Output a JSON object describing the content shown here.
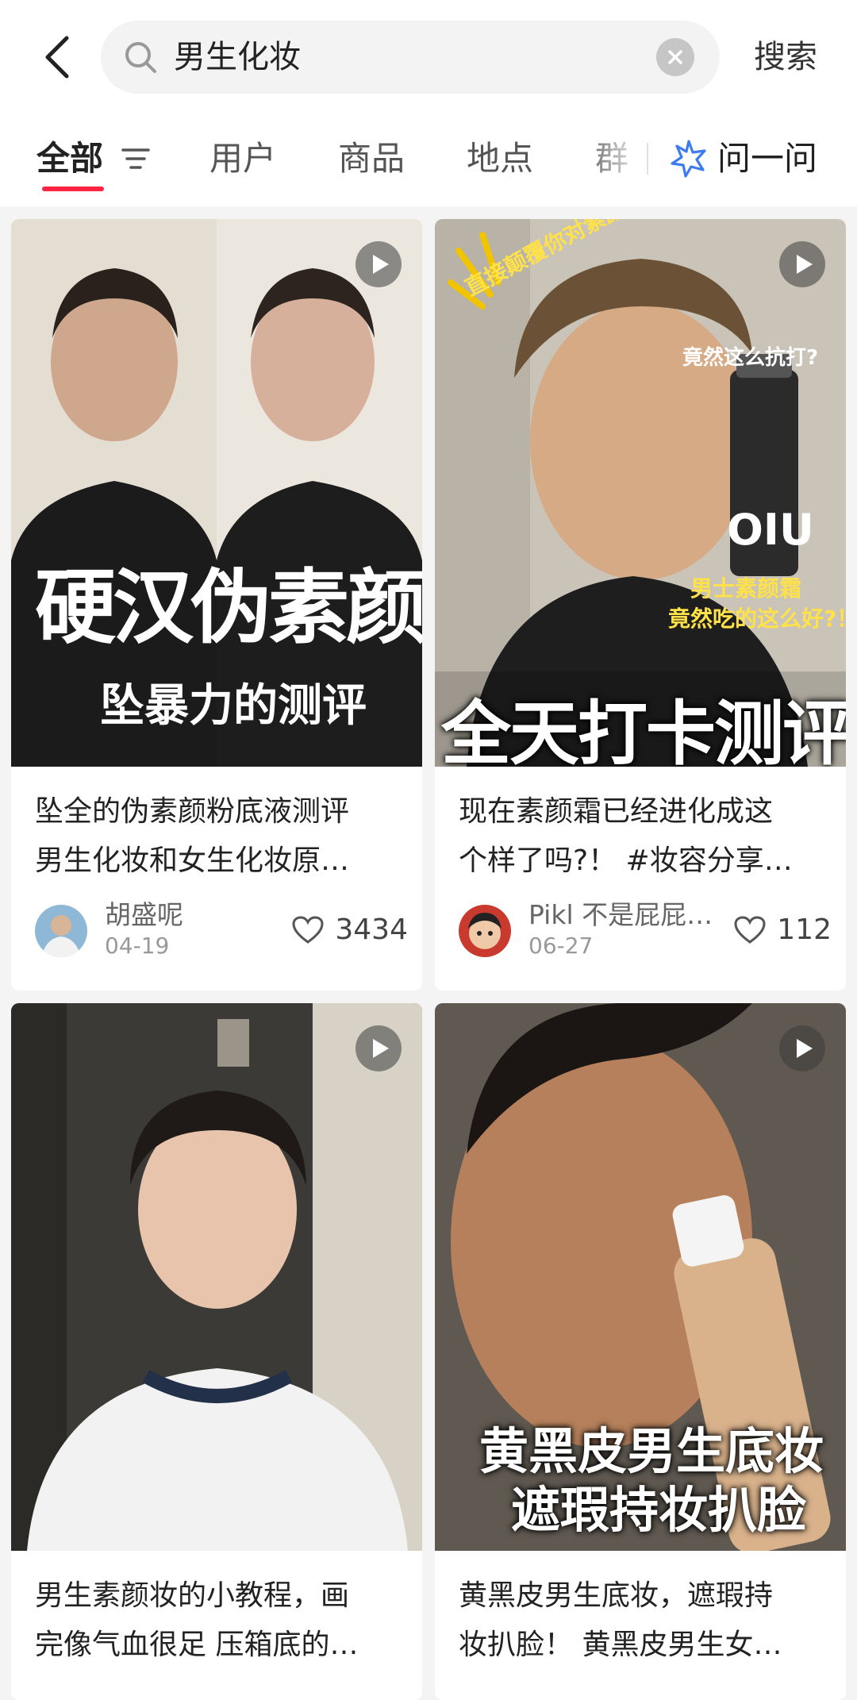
{
  "search": {
    "query": "男生化妆",
    "button_label": "搜索"
  },
  "tabs": [
    {
      "label": "全部"
    },
    {
      "label": "用户"
    },
    {
      "label": "商品"
    },
    {
      "label": "地点"
    },
    {
      "label": "群"
    }
  ],
  "ask": {
    "label": "问一问"
  },
  "accent_color": "#ff2442",
  "posts": [
    {
      "overlay": [
        "硬汉伪素颜",
        "坠暴力的测评"
      ],
      "title_lines": [
        "坠全的伪素颜粉底液测评",
        "男生化妆和女生化妆原…"
      ],
      "author": "胡盛呢",
      "date": "04-19",
      "likes": "3434"
    },
    {
      "overlay": [
        "直接颠覆你对素颜霜的认知！",
        "竟然这么抗打?",
        "OIU",
        "男士素颜霜",
        "竟然吃的这么好?！",
        "全天打卡测评"
      ],
      "title_lines": [
        "现在素颜霜已经进化成这",
        "个样了吗?！ #妆容分享…"
      ],
      "author": "Pikl 不是屁屁…",
      "date": "06-27",
      "likes": "112"
    },
    {
      "overlay": [],
      "title_lines": [
        "男生素颜妆的小教程，画",
        "完像气血很足 压箱底的…"
      ],
      "author": "",
      "date": "",
      "likes": ""
    },
    {
      "overlay": [
        "黄黑皮男生底妆",
        "遮瑕持妆扒脸"
      ],
      "title_lines": [
        "黄黑皮男生底妆，遮瑕持",
        "妆扒脸！ 黄黑皮男生女…"
      ],
      "author": "",
      "date": "",
      "likes": ""
    }
  ]
}
